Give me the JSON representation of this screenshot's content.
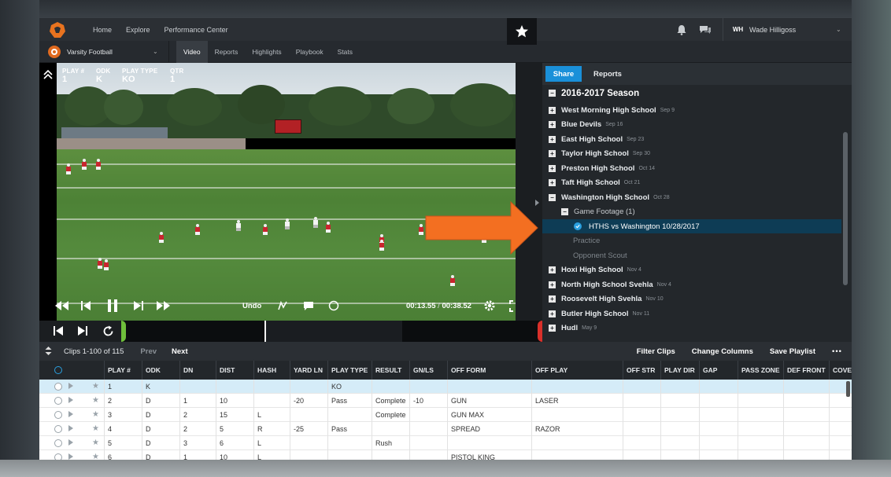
{
  "topnav": {
    "links": [
      "Home",
      "Explore",
      "Performance Center"
    ],
    "user_initials": "WH",
    "user_name": "Wade Hilligoss"
  },
  "subnav": {
    "team": "Varsity Football",
    "tabs": [
      "Video",
      "Reports",
      "Highlights",
      "Playbook",
      "Stats"
    ],
    "active_tab": "Video"
  },
  "video": {
    "info": [
      {
        "label": "PLAY #",
        "value": "1"
      },
      {
        "label": "ODK",
        "value": "K"
      },
      {
        "label": "PLAY TYPE",
        "value": "KO"
      },
      {
        "label": "QTR",
        "value": "1"
      }
    ],
    "undo_label": "Undo",
    "current_time": "00:13.55",
    "time_separator": " / ",
    "total_time": "00:38.52"
  },
  "panel": {
    "share_label": "Share",
    "reports_label": "Reports",
    "season": "2016-2017 Season",
    "teams": [
      {
        "name": "West Morning High School",
        "date": "Sep 9"
      },
      {
        "name": "Blue Devils",
        "date": "Sep 16"
      },
      {
        "name": "East High School",
        "date": "Sep 23"
      },
      {
        "name": "Taylor High School",
        "date": "Sep 30"
      },
      {
        "name": "Preston High School",
        "date": "Oct 14"
      },
      {
        "name": "Taft High School",
        "date": "Oct 21"
      },
      {
        "name": "Washington High School",
        "date": "Oct 28"
      }
    ],
    "game_footage": "Game Footage (1)",
    "selected_video": "HTHS vs Washington 10/28/2017",
    "practice": "Practice",
    "opponent_scout": "Opponent Scout",
    "teams_after": [
      {
        "name": "Hoxi High School",
        "date": "Nov 4"
      },
      {
        "name": "North High School Svehla",
        "date": "Nov 4"
      },
      {
        "name": "Roosevelt High Svehla",
        "date": "Nov 10"
      },
      {
        "name": "Butler High School",
        "date": "Nov 11"
      },
      {
        "name": "Hudl",
        "date": "May 9"
      }
    ]
  },
  "clips": {
    "count": "Clips 1-100 of 115",
    "prev": "Prev",
    "next": "Next",
    "filter": "Filter Clips",
    "change_columns": "Change Columns",
    "save_playlist": "Save Playlist",
    "more": "•••"
  },
  "table": {
    "columns": [
      "PLAY #",
      "ODK",
      "DN",
      "DIST",
      "HASH",
      "YARD LN",
      "PLAY TYPE",
      "RESULT",
      "GN/LS",
      "OFF FORM",
      "OFF PLAY",
      "OFF STR",
      "PLAY DIR",
      "GAP",
      "PASS ZONE",
      "DEF FRONT",
      "COVE"
    ],
    "rows": [
      [
        "1",
        "K",
        "",
        "",
        "",
        "",
        "KO",
        "",
        "",
        "",
        "",
        "",
        "",
        "",
        "",
        "",
        ""
      ],
      [
        "2",
        "D",
        "1",
        "10",
        "",
        "-20",
        "Pass",
        "Complete",
        "-10",
        "GUN",
        "LASER",
        "",
        "",
        "",
        "",
        "",
        ""
      ],
      [
        "3",
        "D",
        "2",
        "15",
        "L",
        "",
        "",
        "Complete",
        "",
        "GUN MAX",
        "",
        "",
        "",
        "",
        "",
        "",
        ""
      ],
      [
        "4",
        "D",
        "2",
        "5",
        "R",
        "-25",
        "Pass",
        "",
        "",
        "SPREAD",
        "RAZOR",
        "",
        "",
        "",
        "",
        "",
        ""
      ],
      [
        "5",
        "D",
        "3",
        "6",
        "L",
        "",
        "",
        "Rush",
        "",
        "",
        "",
        "",
        "",
        "",
        "",
        "",
        ""
      ],
      [
        "6",
        "D",
        "1",
        "10",
        "L",
        "",
        "",
        "",
        "",
        "PISTOL KING",
        "",
        "",
        "",
        "",
        "",
        "",
        ""
      ]
    ]
  },
  "colors": {
    "accent": "#1a90d9",
    "brand": "#e06a1f",
    "highlight_row": "#d5ecf8",
    "selected_tree": "#0e3c55"
  }
}
